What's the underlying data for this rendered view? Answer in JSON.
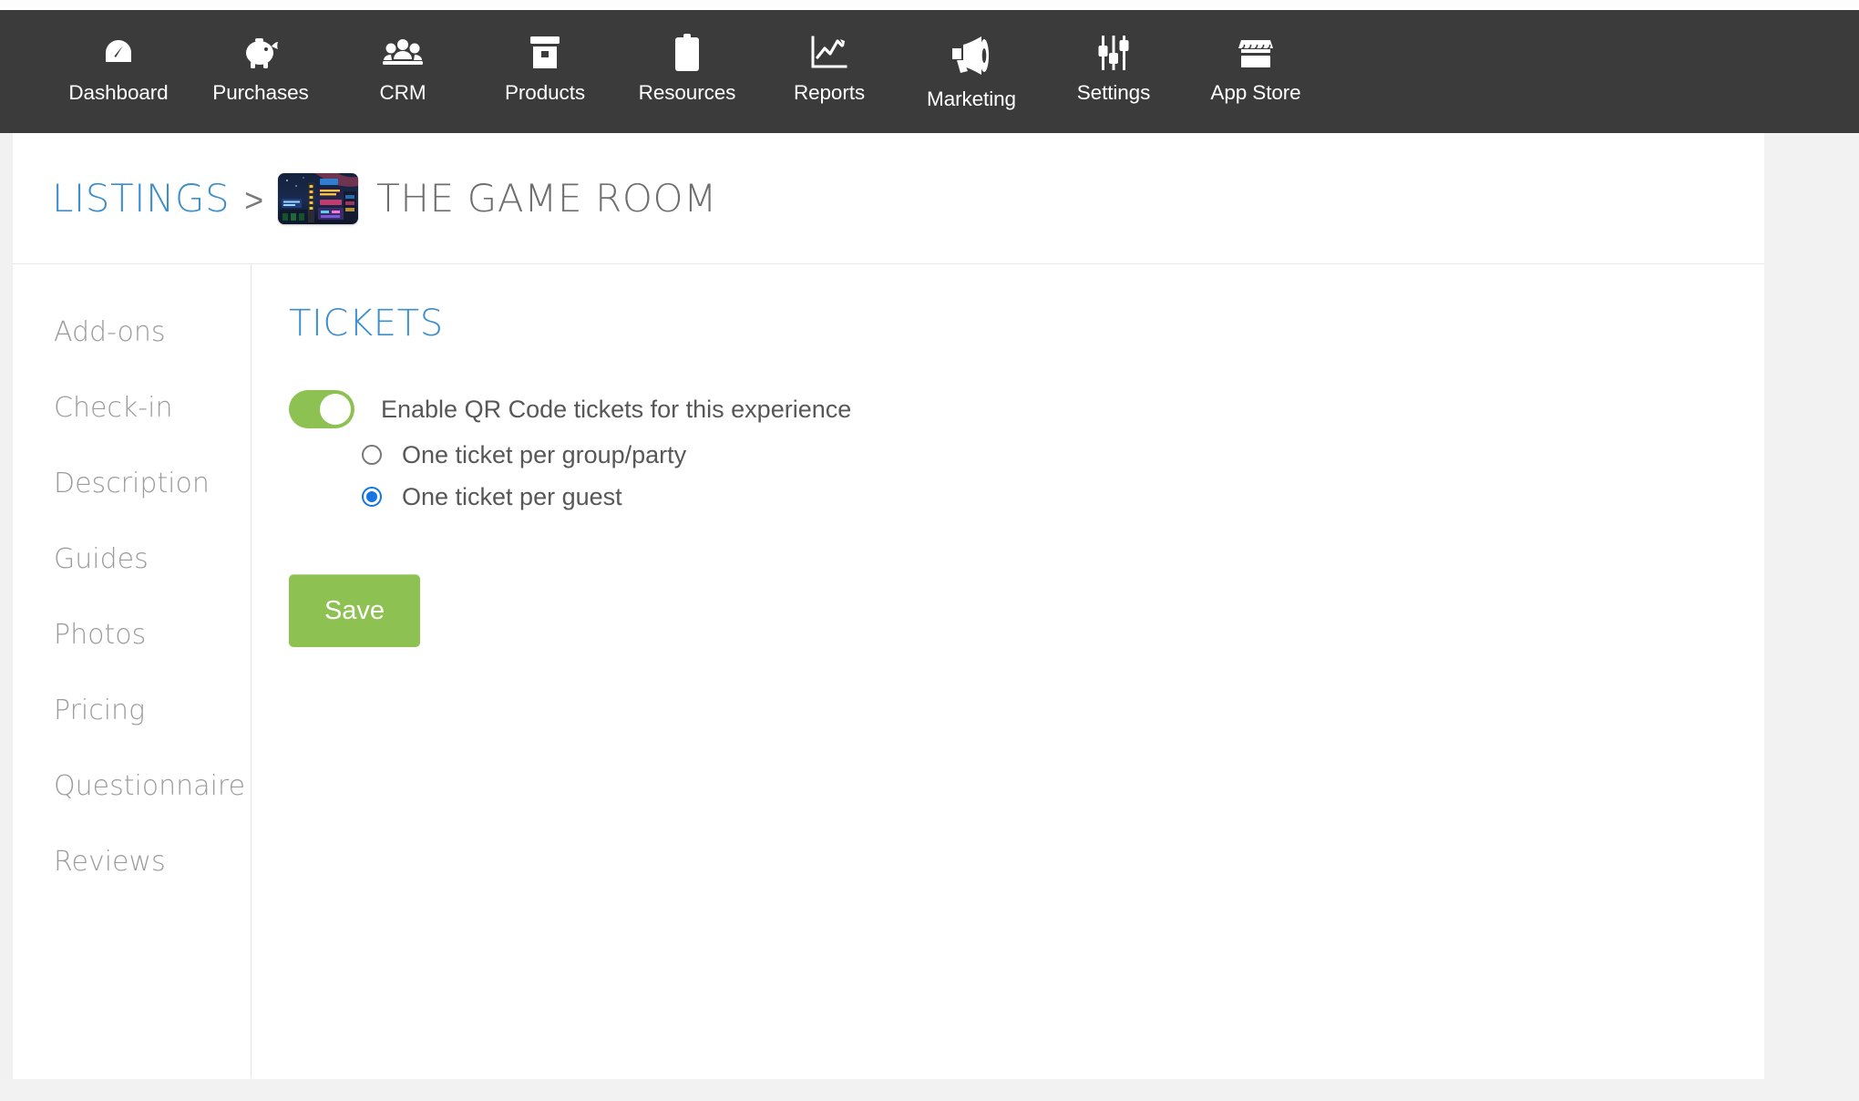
{
  "nav": {
    "items": [
      {
        "label": "Dashboard",
        "icon": "gauge-icon"
      },
      {
        "label": "Purchases",
        "icon": "piggy-bank-icon"
      },
      {
        "label": "CRM",
        "icon": "people-group-icon"
      },
      {
        "label": "Products",
        "icon": "box-icon"
      },
      {
        "label": "Resources",
        "icon": "clipboard-icon"
      },
      {
        "label": "Reports",
        "icon": "line-chart-icon"
      },
      {
        "label": "Marketing",
        "icon": "megaphone-icon"
      },
      {
        "label": "Settings",
        "icon": "sliders-icon"
      },
      {
        "label": "App Store",
        "icon": "storefront-icon"
      }
    ],
    "background_color": "#3b3b3b",
    "label_color": "#ffffff"
  },
  "breadcrumb": {
    "root_label": "LISTINGS",
    "separator": ">",
    "thumbnail_name": "listing-thumbnail-neon-arcade",
    "title": "THE GAME ROOM",
    "link_color": "#3e8ecb",
    "title_color": "#6e6e6e"
  },
  "sidebar": {
    "items": [
      {
        "label": "Add-ons"
      },
      {
        "label": "Check-in"
      },
      {
        "label": "Description"
      },
      {
        "label": "Guides"
      },
      {
        "label": "Photos"
      },
      {
        "label": "Pricing"
      },
      {
        "label": "Questionnaire"
      },
      {
        "label": "Reviews"
      }
    ],
    "text_color": "#9b9b9b"
  },
  "main": {
    "section_title": "TICKETS",
    "section_title_color": "#3e8ecb",
    "toggle": {
      "label": "Enable QR Code tickets for this experience",
      "state": "on",
      "on_color": "#8dc152"
    },
    "radios": [
      {
        "label": "One ticket per group/party",
        "selected": false
      },
      {
        "label": "One ticket per guest",
        "selected": true
      }
    ],
    "radio_selected_color": "#1675e0",
    "save_label": "Save",
    "save_color": "#8dc152"
  }
}
